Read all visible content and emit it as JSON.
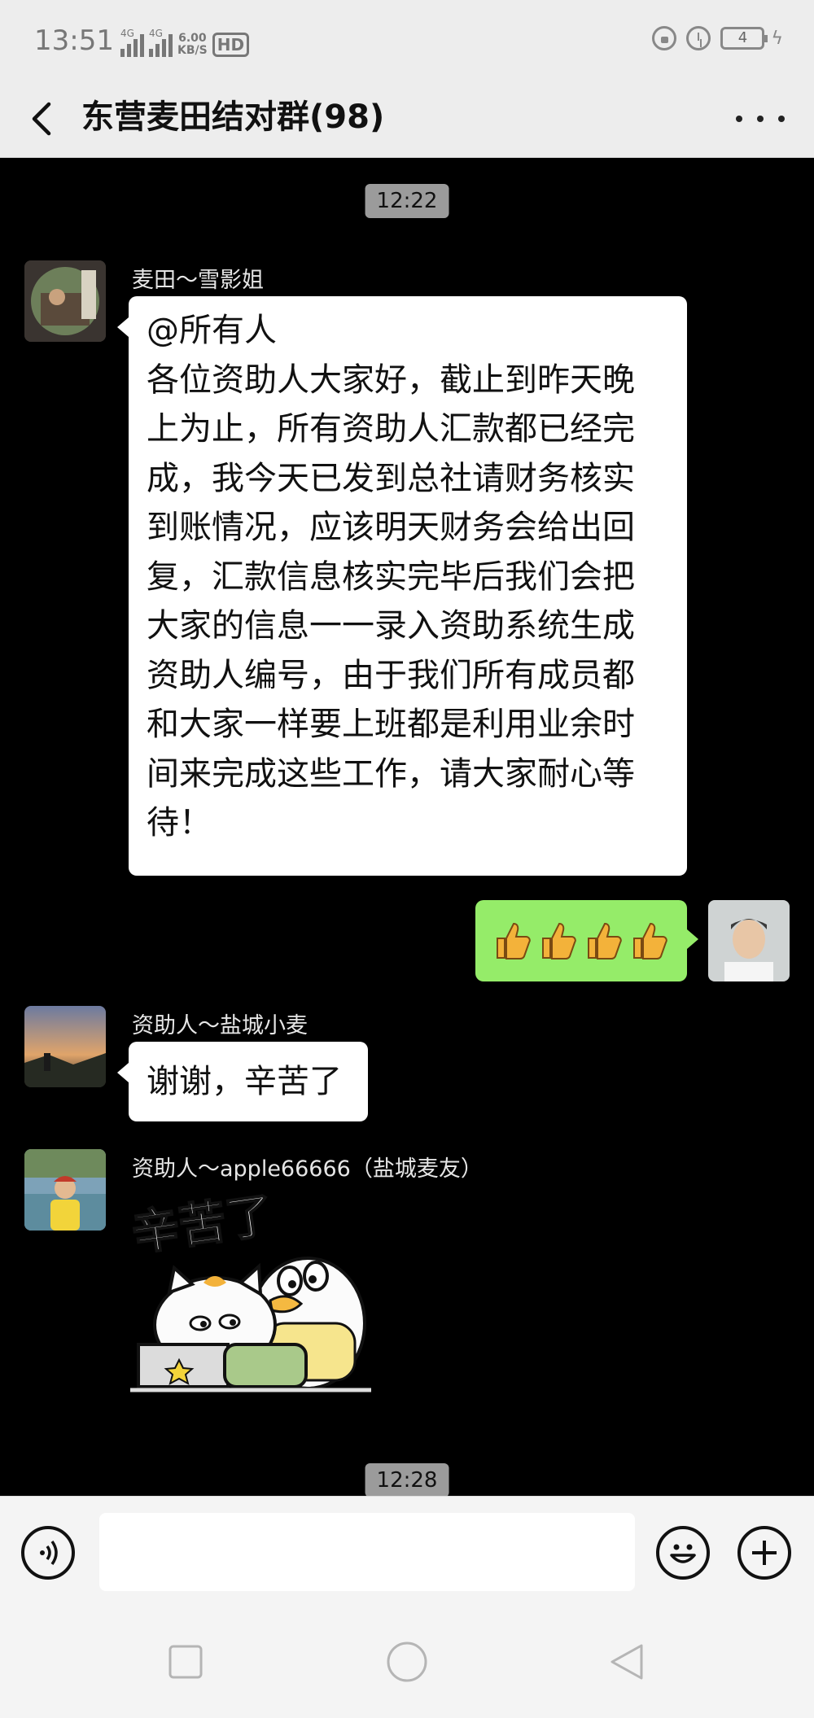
{
  "status_bar": {
    "time": "13:51",
    "network_1": "4G",
    "network_2": "4G",
    "speed_value": "6.00",
    "speed_unit": "KB/S",
    "hd_label": "HD",
    "battery": "4"
  },
  "header": {
    "title": "东营麦田结对群(98)"
  },
  "chat": {
    "timestamps": [
      "12:22",
      "12:28"
    ],
    "messages": [
      {
        "sender": "麦田～雪影姐",
        "lines": [
          "@所有人",
          "各位资助人大家好，截止到昨天晚",
          "上为止，所有资助人汇款都已经完",
          "成，我今天已发到总社请财务核实",
          "到账情况，应该明天财务会给出回",
          "复，汇款信息核实完毕后我们会把",
          "大家的信息一一录入资助系统生成",
          "资助人编号，由于我们所有成员都",
          "和大家一样要上班都是利用业余时",
          "间来完成这些工作，请大家耐心等",
          "待！"
        ]
      },
      {
        "sender": "me",
        "emoji": "thumbs-up x4"
      },
      {
        "sender": "资助人～盐城小麦",
        "text": "谢谢，辛苦了"
      },
      {
        "sender": "资助人～apple66666（盐城麦友）",
        "sticker_text": "辛苦了"
      }
    ]
  },
  "colors": {
    "chat_background": "#000000",
    "my_bubble": "#95ec69",
    "other_bubble": "#ffffff",
    "bar_background": "#ededed"
  }
}
